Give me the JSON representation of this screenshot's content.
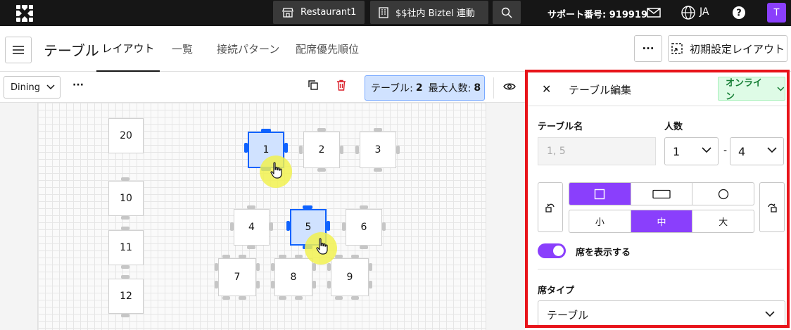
{
  "topbar": {
    "restaurant_label": "Restaurant1",
    "integration_label": "$$社内 Biztel 連動",
    "support_text": "サポート番号: 919919",
    "language": "JA",
    "avatar_initial": "T"
  },
  "header": {
    "page_title": "テーブル",
    "tabs": [
      {
        "label": "レイアウト",
        "active": true
      },
      {
        "label": "一覧",
        "active": false
      },
      {
        "label": "接続パターン",
        "active": false
      },
      {
        "label": "配席優先順位",
        "active": false
      }
    ],
    "more_label": "···",
    "reset_layout_label": "初期設定レイアウト"
  },
  "toolbar": {
    "area_select": "Dining",
    "more_label": "···",
    "tables_label": "テーブル:",
    "tables_count": "2",
    "max_label": "最大人数:",
    "max_count": "8"
  },
  "floor": {
    "tables": [
      "20",
      "1",
      "2",
      "3",
      "10",
      "4",
      "5",
      "6",
      "11",
      "7",
      "8",
      "9",
      "12"
    ]
  },
  "panel": {
    "title": "テーブル編集",
    "status": "オンライン",
    "name_label": "テーブル名",
    "name_placeholder": "1, 5",
    "capacity_label": "人数",
    "capacity_min": "1",
    "capacity_sep": "-",
    "capacity_max": "4",
    "sizes": [
      {
        "label": "小",
        "selected": false
      },
      {
        "label": "中",
        "selected": true
      },
      {
        "label": "大",
        "selected": false
      }
    ],
    "show_seats_label": "席を表示する",
    "seat_type_label": "席タイプ",
    "seat_type_value": "テーブル"
  },
  "colors": {
    "accent": "#8a3ffc",
    "selected_table": "#d0e2ff",
    "selected_border": "#0f62fe",
    "highlight_frame": "#e8141a",
    "online": "#198038"
  }
}
